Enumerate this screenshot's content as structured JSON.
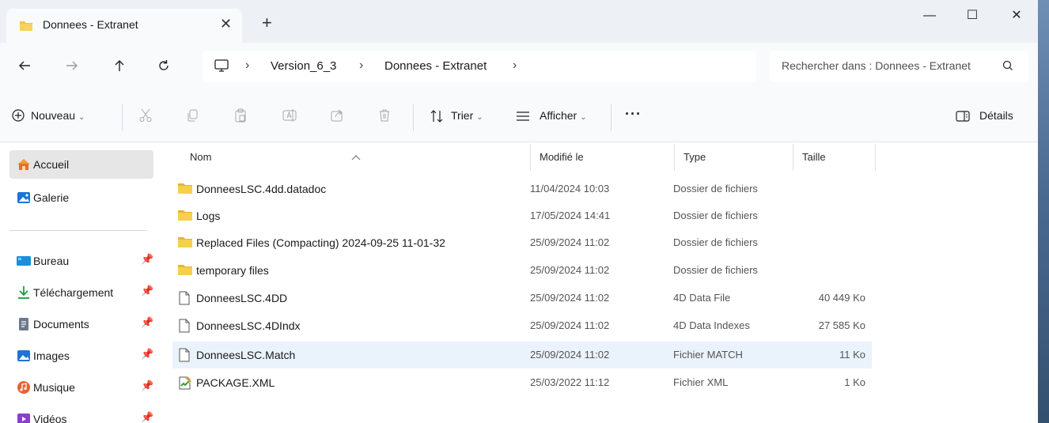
{
  "window": {
    "tab_title": "Donnees - Extranet",
    "tab_close": "✕",
    "new_tab": "+",
    "minimize": "—",
    "maximize": "☐",
    "close": "✕"
  },
  "address": {
    "breadcrumb": [
      "Version_6_3",
      "Donnees - Extranet"
    ],
    "separator": "›",
    "search_placeholder": "Rechercher dans : Donnees - Extranet"
  },
  "toolbar": {
    "new_label": "Nouveau",
    "sort_label": "Trier",
    "view_label": "Afficher",
    "more_label": "···",
    "details_label": "Détails",
    "chevron": "⌄"
  },
  "sidebar": {
    "items": [
      {
        "label": "Accueil",
        "icon": "home-icon"
      },
      {
        "label": "Galerie",
        "icon": "gallery-icon"
      },
      {
        "label": "Bureau",
        "icon": "desktop-icon"
      },
      {
        "label": "Téléchargement",
        "icon": "download-icon"
      },
      {
        "label": "Documents",
        "icon": "documents-icon"
      },
      {
        "label": "Images",
        "icon": "images-icon"
      },
      {
        "label": "Musique",
        "icon": "music-icon"
      },
      {
        "label": "Vidéos",
        "icon": "videos-icon"
      }
    ],
    "pin_glyph": "📌"
  },
  "columns": {
    "name": "Nom",
    "modified": "Modifié le",
    "type": "Type",
    "size": "Taille"
  },
  "files": [
    {
      "name": "DonneesLSC.4dd.datadoc",
      "modified": "11/04/2024 10:03",
      "type": "Dossier de fichiers",
      "size": "",
      "kind": "folder"
    },
    {
      "name": "Logs",
      "modified": "17/05/2024 14:41",
      "type": "Dossier de fichiers",
      "size": "",
      "kind": "folder"
    },
    {
      "name": "Replaced Files (Compacting) 2024-09-25 11-01-32",
      "modified": "25/09/2024 11:02",
      "type": "Dossier de fichiers",
      "size": "",
      "kind": "folder"
    },
    {
      "name": "temporary files",
      "modified": "25/09/2024 11:02",
      "type": "Dossier de fichiers",
      "size": "",
      "kind": "folder"
    },
    {
      "name": "DonneesLSC.4DD",
      "modified": "25/09/2024 11:02",
      "type": "4D Data File",
      "size": "40 449 Ko",
      "kind": "file"
    },
    {
      "name": "DonneesLSC.4DIndx",
      "modified": "25/09/2024 11:02",
      "type": "4D Data Indexes",
      "size": "27 585 Ko",
      "kind": "file"
    },
    {
      "name": "DonneesLSC.Match",
      "modified": "25/09/2024 11:02",
      "type": "Fichier MATCH",
      "size": "11 Ko",
      "kind": "file"
    },
    {
      "name": "PACKAGE.XML",
      "modified": "25/03/2022 11:12",
      "type": "Fichier XML",
      "size": "1 Ko",
      "kind": "xml"
    }
  ],
  "colors": {
    "folder": "#f4c542",
    "selected_row": "#eaf2fb",
    "accent": "#0067c0"
  }
}
